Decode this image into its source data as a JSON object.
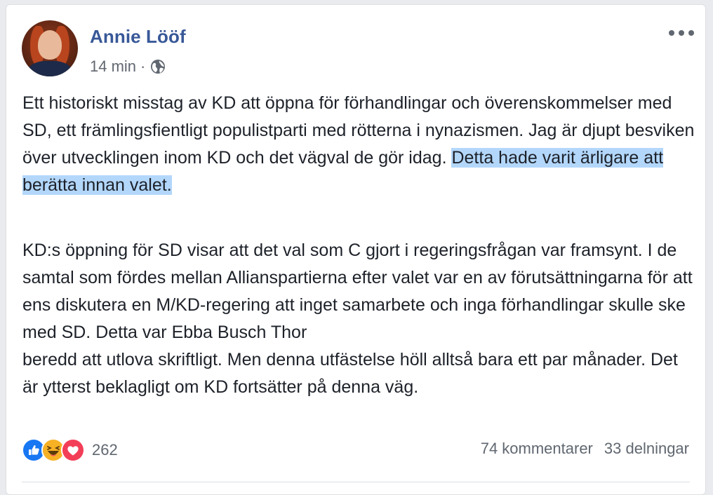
{
  "post": {
    "author": "Annie Lööf",
    "time": "14 min",
    "separator": "·",
    "privacy_icon": "globe-icon",
    "more_icon": "more-options-icon",
    "paragraph1_text": "Ett historiskt misstag av KD att öppna för förhandlingar och överenskommelser med SD, ett främlingsfientligt populistparti med rötterna i nynazismen. Jag är djupt besviken över utvecklingen inom KD och det vägval de gör idag. ",
    "paragraph1_highlight": "Detta hade varit ärligare att berätta innan valet.",
    "paragraph2_line1": "KD:s öppning för SD visar att det val som C gjort i regeringsfrågan var framsynt. I de samtal som fördes mellan Allianspartierna efter valet var en av förutsättningarna för att ens diskutera en M/KD-regering att inget samarbete och inga förhandlingar skulle ske med SD. Detta var Ebba Busch Thor",
    "paragraph2_line2": "beredd att utlova skriftligt. Men denna utfästelse höll alltså bara ett par månader. Det är ytterst beklagligt om KD fortsätter på denna väg."
  },
  "reactions": {
    "icons": [
      "like-icon",
      "haha-icon",
      "love-icon"
    ],
    "count": "262",
    "comments": "74 kommentarer",
    "shares": "33 delningar"
  },
  "colors": {
    "name": "#385898",
    "highlight": "#b3d7fb",
    "like": "#1877f2",
    "haha": "#f7b125",
    "love": "#f33e58"
  }
}
